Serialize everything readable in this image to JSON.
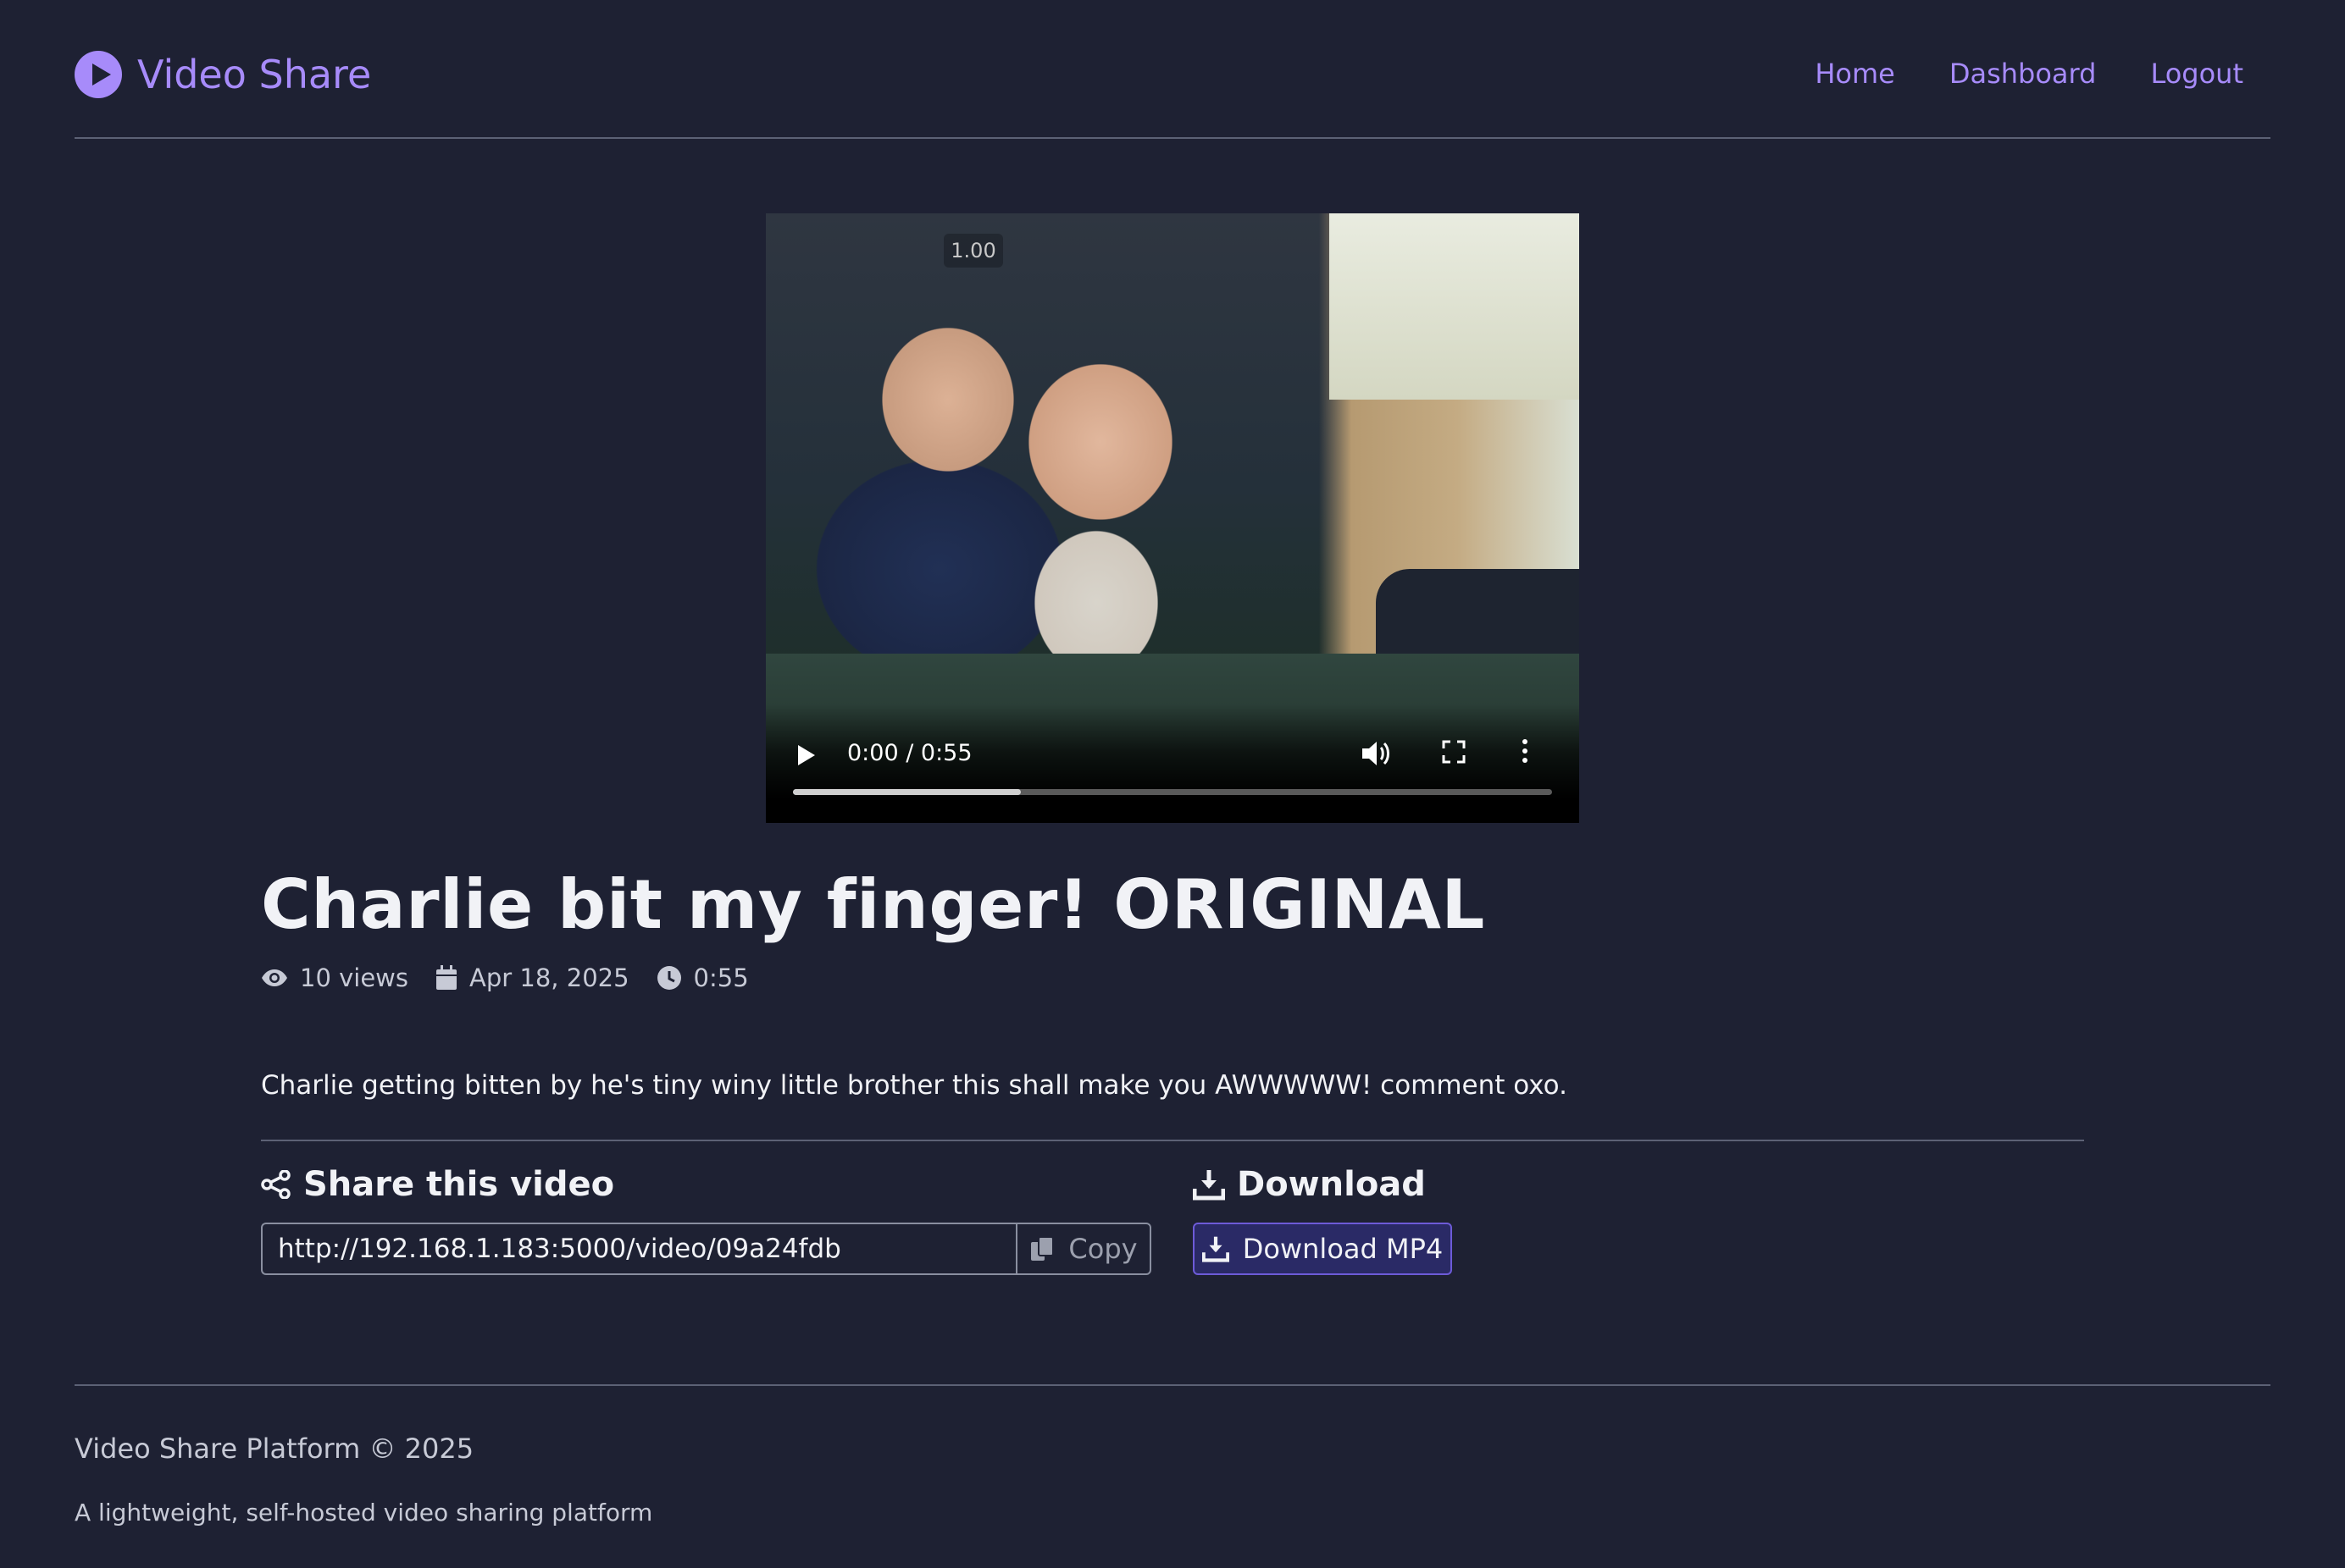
{
  "header": {
    "brand": "Video Share",
    "brand_icon": "play-circle-icon",
    "nav": [
      "Home",
      "Dashboard",
      "Logout"
    ]
  },
  "video": {
    "speed": "1.00",
    "time": "0:00 / 0:55",
    "buffered_fraction": 0.3,
    "icons": [
      "play-icon",
      "volume-icon",
      "fullscreen-icon",
      "more-options-icon"
    ]
  },
  "details": {
    "title": "Charlie bit my finger! ORIGINAL",
    "views": "10 views",
    "date": "Apr 18, 2025",
    "duration": "0:55",
    "description": "Charlie getting bitten by he's tiny winy little brother this shall make you AWWWWW! comment oxo."
  },
  "share": {
    "heading": "Share this video",
    "url": "http://192.168.1.183:5000/video/09a24fdb",
    "copy_label": "Copy"
  },
  "download": {
    "heading": "Download",
    "button_label": "Download MP4"
  },
  "footer": {
    "copyright": "Video Share Platform © 2025",
    "tagline": "A lightweight, self-hosted video sharing platform"
  },
  "colors": {
    "background": "#1e2133",
    "accent": "#a78bfa",
    "download_button": "#2a2a66"
  }
}
